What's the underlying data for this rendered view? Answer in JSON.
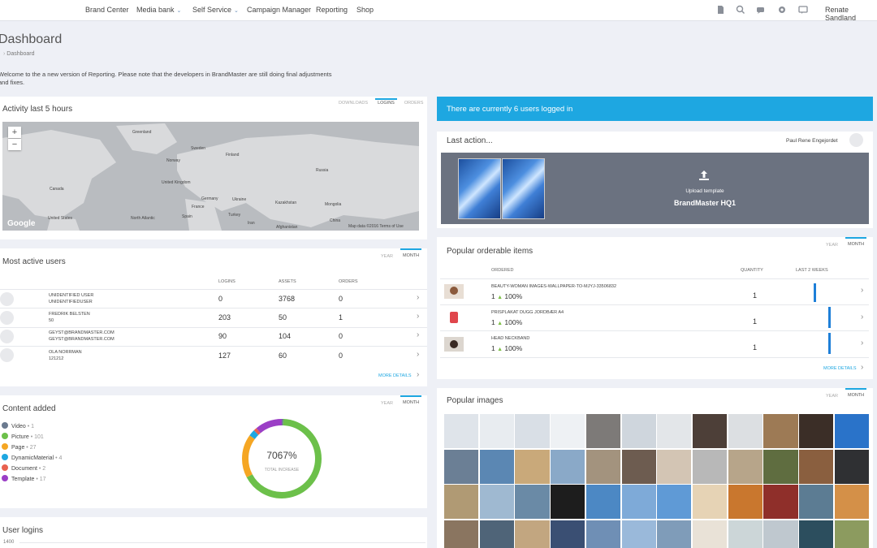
{
  "nav": {
    "items": [
      {
        "label": "Brand Center",
        "dropdown": false
      },
      {
        "label": "Media bank",
        "dropdown": true
      },
      {
        "label": "Self Service",
        "dropdown": true
      },
      {
        "label": "Campaign Manager",
        "dropdown": false
      },
      {
        "label": "Reporting",
        "dropdown": false
      },
      {
        "label": "Shop",
        "dropdown": false
      }
    ],
    "icons": [
      "document-icon",
      "search-icon",
      "chat-icon",
      "gear-icon",
      "comment-icon"
    ],
    "user": "Renate Sandland"
  },
  "page": {
    "title": "Dashboard",
    "breadcrumb": "Dashboard",
    "welcome": "Welcome to the a new version of Reporting. Please note that the developers in BrandMaster are still doing final adjustments and fixes."
  },
  "activity": {
    "title": "Activity last 5 hours",
    "tabs": [
      "DOWNLOADS",
      "LOGINS",
      "ORDERS"
    ],
    "active_tab": 1,
    "zoom_in": "+",
    "zoom_out": "−",
    "map_labels": [
      "Greenland",
      "Sweden",
      "Canada",
      "Norway",
      "Finland",
      "United Kingdom",
      "Germany",
      "Ukraine",
      "Kazakhstan",
      "Mongolia",
      "Russia",
      "France",
      "Spain",
      "Turkey",
      "China",
      "United States",
      "North Atlantic",
      "Iran",
      "Afghanistan"
    ],
    "google": "Google",
    "map_footer": "Map data ©2016   Terms of Use"
  },
  "most_active": {
    "title": "Most active users",
    "tabs": [
      "YEAR",
      "MONTH"
    ],
    "active_tab": 1,
    "columns": [
      "LOGINS",
      "ASSETS",
      "ORDERS"
    ],
    "rows": [
      {
        "name": "UNIDENTIFIED USER",
        "sub": "UNIDENTIFIEDUSER",
        "logins": "0",
        "assets": "3768",
        "orders": "0"
      },
      {
        "name": "FREDRIK BELSTEN",
        "sub": "50",
        "logins": "203",
        "assets": "50",
        "orders": "1"
      },
      {
        "name": "GEYST@BRANDMASTER.COM",
        "sub": "GEYST@BRANDMASTER.COM",
        "logins": "90",
        "assets": "104",
        "orders": "0"
      },
      {
        "name": "OLA NORRMAN",
        "sub": "121212",
        "logins": "127",
        "assets": "60",
        "orders": "0"
      }
    ],
    "more": "MORE DETAILS"
  },
  "content_added": {
    "title": "Content added",
    "tabs": [
      "YEAR",
      "MONTH"
    ],
    "active_tab": 1,
    "legend": [
      {
        "label": "Video",
        "count": "• 1",
        "color": "#6b7a8f"
      },
      {
        "label": "Picture",
        "count": "• 101",
        "color": "#6cc04a"
      },
      {
        "label": "Page",
        "count": "• 27",
        "color": "#f5a623"
      },
      {
        "label": "DynamicMaterial",
        "count": "• 4",
        "color": "#1ea7e1"
      },
      {
        "label": "Document",
        "count": "• 2",
        "color": "#e8614f"
      },
      {
        "label": "Template",
        "count": "• 17",
        "color": "#9b3fc6"
      }
    ],
    "total_value": "7067%",
    "total_label": "TOTAL INCREASE"
  },
  "user_logins": {
    "title": "User logins",
    "axis_label": "1400"
  },
  "logged_in": {
    "text": "There are currently 6 users logged in"
  },
  "last_action": {
    "title": "Last action...",
    "user": "Paul Rene Engejordet",
    "action_label": "Upload template",
    "action_target": "BrandMaster HQ1"
  },
  "orderable": {
    "title": "Popular orderable items",
    "tabs": [
      "YEAR",
      "MONTH"
    ],
    "active_tab": 1,
    "columns": [
      "ORDERED",
      "QUANTITY",
      "LAST 2 WEEKS"
    ],
    "rows": [
      {
        "name": "BEAUTY-WOMAN IMAGES-WALLPAPER-TO-MJYJ-33506832",
        "ordered": "1",
        "change": "100%",
        "quantity": "1",
        "trend": 0.9
      },
      {
        "name": "PRISPLAKAT DUGG JORDBÆR A4",
        "ordered": "1",
        "change": "100%",
        "quantity": "1",
        "trend": 1.0
      },
      {
        "name": "HEAD NECKBAND",
        "ordered": "1",
        "change": "100%",
        "quantity": "1",
        "trend": 1.0
      }
    ],
    "more": "MORE DETAILS"
  },
  "popular_images": {
    "title": "Popular images",
    "tabs": [
      "YEAR",
      "MONTH"
    ],
    "active_tab": 1,
    "tile_colors": [
      "#dfe4ea",
      "#e8ecf0",
      "#d9dfe6",
      "#eef1f4",
      "#7d7a78",
      "#cfd6dd",
      "#e3e6e9",
      "#4d3f38",
      "#dcdfe2",
      "#9d7a55",
      "#3b2e27",
      "#2a73c9",
      "#6b7f95",
      "#5b87b3",
      "#c9a97a",
      "#8aa9c8",
      "#a3937e",
      "#6d5c50",
      "#d3c5b4",
      "#b8b8b8",
      "#b7a58a",
      "#5f6d40",
      "#8a5f3f",
      "#2f3033",
      "#b09a74",
      "#9fb9d1",
      "#6a8aa6",
      "#1d1d1d",
      "#4c88c4",
      "#7eaad8",
      "#5f9ad6",
      "#e6d3b5",
      "#c9772e",
      "#8f2f2a",
      "#5c7c93",
      "#d49048",
      "#8a7560",
      "#4f6478",
      "#c2a680",
      "#3a4f73",
      "#6f8fb5",
      "#9ab9da",
      "#7f9cb9",
      "#e9e2d7",
      "#ccd6d8",
      "#bfc8cf",
      "#2c4e5e",
      "#8c9b5f"
    ]
  }
}
